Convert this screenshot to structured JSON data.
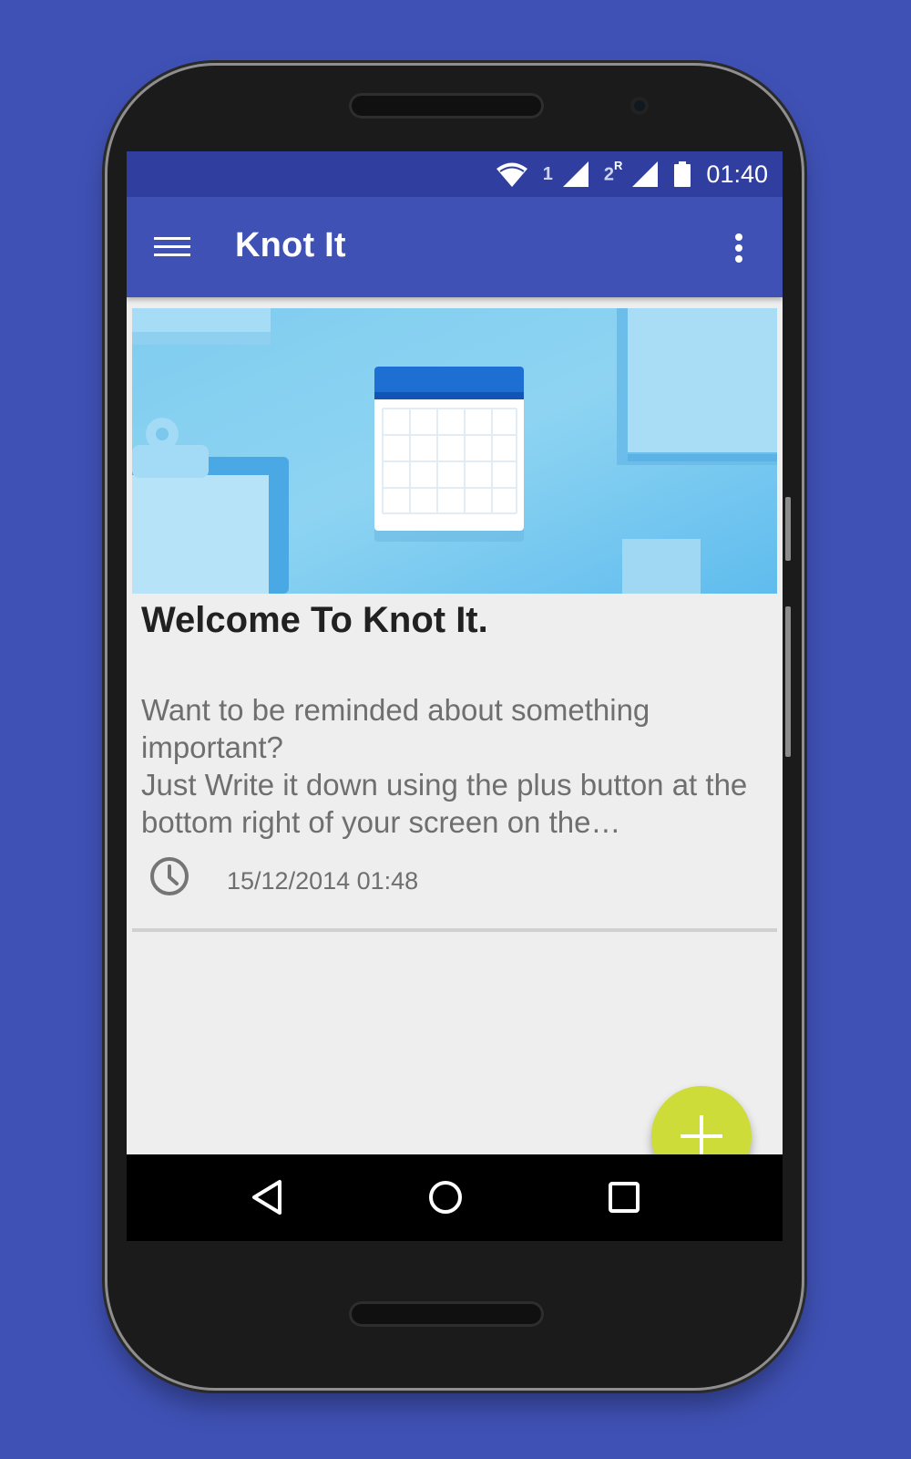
{
  "statusbar": {
    "sim1_label": "1",
    "sim2_label": "2",
    "roaming_label": "R",
    "time": "01:40",
    "icons": [
      "wifi-icon",
      "signal-icon",
      "signal-icon",
      "battery-icon"
    ]
  },
  "appbar": {
    "title": "Knot It",
    "menu_icon": "hamburger-menu-icon",
    "overflow_icon": "more-vert-icon"
  },
  "note_card": {
    "title": "Welcome To Knot It.",
    "body": "Want to be reminded about something important?\nJust Write it down using the plus button at the bottom right of your screen on the…",
    "date": "15/12/2014 01:48",
    "date_icon": "clock-icon"
  },
  "fab": {
    "icon": "plus-icon"
  },
  "navbar": {
    "icons": [
      "back-icon",
      "home-icon",
      "recents-icon"
    ]
  },
  "colors": {
    "background": "#3f51b5",
    "statusbar": "#303f9f",
    "appbar": "#3f51b5",
    "fab": "#cddc39",
    "screen": "#eeeeee"
  }
}
